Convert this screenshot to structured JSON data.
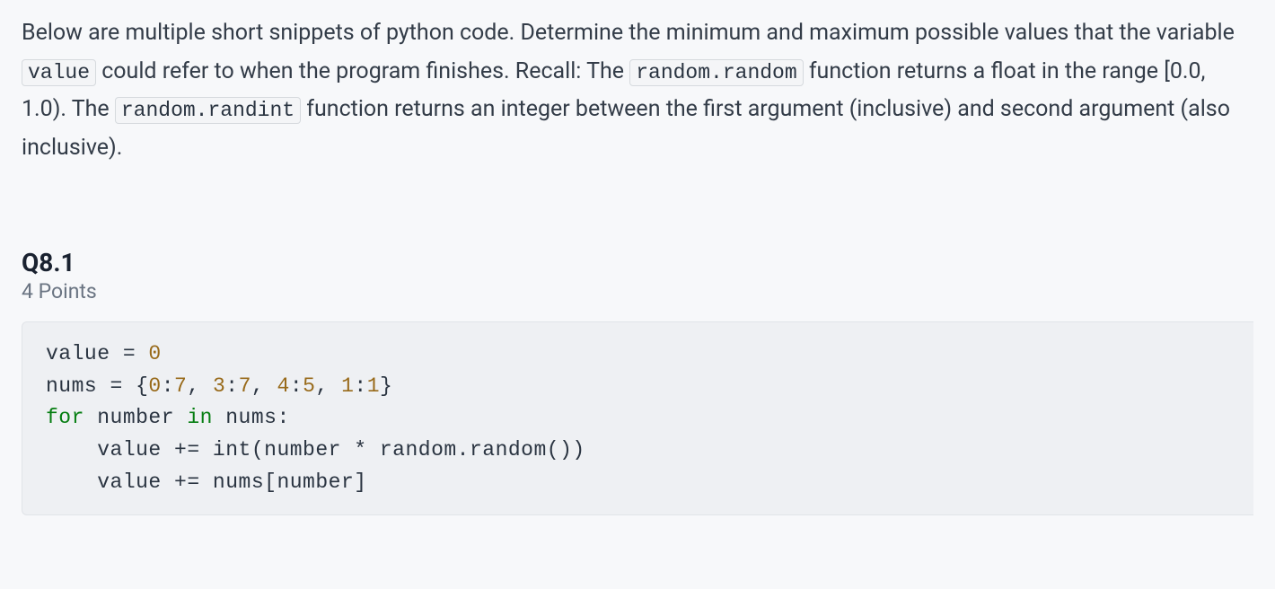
{
  "instructions": {
    "part1": "Below are multiple short snippets of python code. Determine the minimum and maximum possible values that the variable ",
    "code1": "value",
    "part2": " could refer to when the program finishes. Recall: The ",
    "code2": "random.random",
    "part3": " function returns a float in the range [0.0, 1.0). The ",
    "code3": "random.randint",
    "part4": " function returns an integer between the first argument (inclusive) and second argument (also inclusive)."
  },
  "question": {
    "number": "Q8.1",
    "points": "4 Points"
  },
  "code": {
    "l1_a": "value = ",
    "l1_n": "0",
    "l2_a": "nums = {",
    "l2_n1": "0",
    "l2_c1": ":",
    "l2_n2": "7",
    "l2_c2": ", ",
    "l2_n3": "3",
    "l2_c3": ":",
    "l2_n4": "7",
    "l2_c4": ", ",
    "l2_n5": "4",
    "l2_c5": ":",
    "l2_n6": "5",
    "l2_c6": ", ",
    "l2_n7": "1",
    "l2_c7": ":",
    "l2_n8": "1",
    "l2_b": "}",
    "l3_kw1": "for",
    "l3_mid": " number ",
    "l3_kw2": "in",
    "l3_end": " nums:",
    "l4": "    value += int(number * random.random())",
    "l5": "    value += nums[number]"
  }
}
